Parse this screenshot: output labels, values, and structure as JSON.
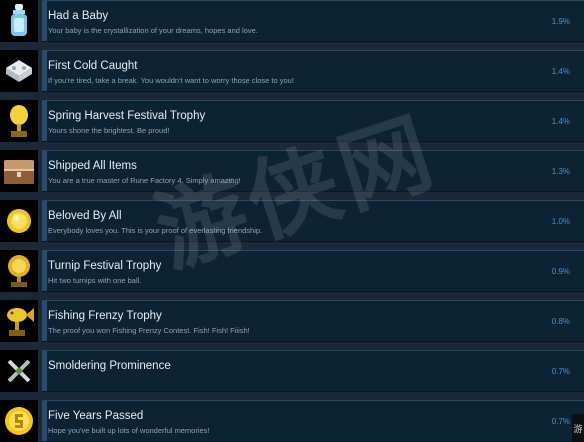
{
  "achievements": [
    {
      "icon": "baby-bottle-icon",
      "title": "Had a Baby",
      "description": "Your baby is the crystallization of your dreams, hopes and love.",
      "percent": "1.9%"
    },
    {
      "icon": "cold-pills-icon",
      "title": "First Cold Caught",
      "description": "If you're tired, take a break. You wouldn't want to worry those close to you!",
      "percent": "1.4%"
    },
    {
      "icon": "harvest-trophy-icon",
      "title": "Spring Harvest Festival Trophy",
      "description": "Yours shone the brightest. Be proud!",
      "percent": "1.4%"
    },
    {
      "icon": "shipping-box-icon",
      "title": "Shipped All Items",
      "description": "You are a true master of Rune Factory 4. Simply amazing!",
      "percent": "1.3%"
    },
    {
      "icon": "gold-medal-icon",
      "title": "Beloved By All",
      "description": "Everybody loves you. This is your proof of everlasting friendship.",
      "percent": "1.0%"
    },
    {
      "icon": "turnip-trophy-icon",
      "title": "Turnip Festival Trophy",
      "description": "Hit two turnips with one ball.",
      "percent": "0.9%"
    },
    {
      "icon": "fish-trophy-icon",
      "title": "Fishing Frenzy Trophy",
      "description": "The proof you won Fishing Frenzy Contest. Fish! Fish! Fiiish!",
      "percent": "0.8%"
    },
    {
      "icon": "crossed-swords-icon",
      "title": "Smoldering Prominence",
      "description": "",
      "percent": "0.7%"
    },
    {
      "icon": "five-years-medal-icon",
      "title": "Five Years Passed",
      "description": "Hope you've built up lots of wonderful memories!",
      "percent": "0.7%"
    }
  ],
  "watermark": "游侠网",
  "edge_glyph": "游"
}
